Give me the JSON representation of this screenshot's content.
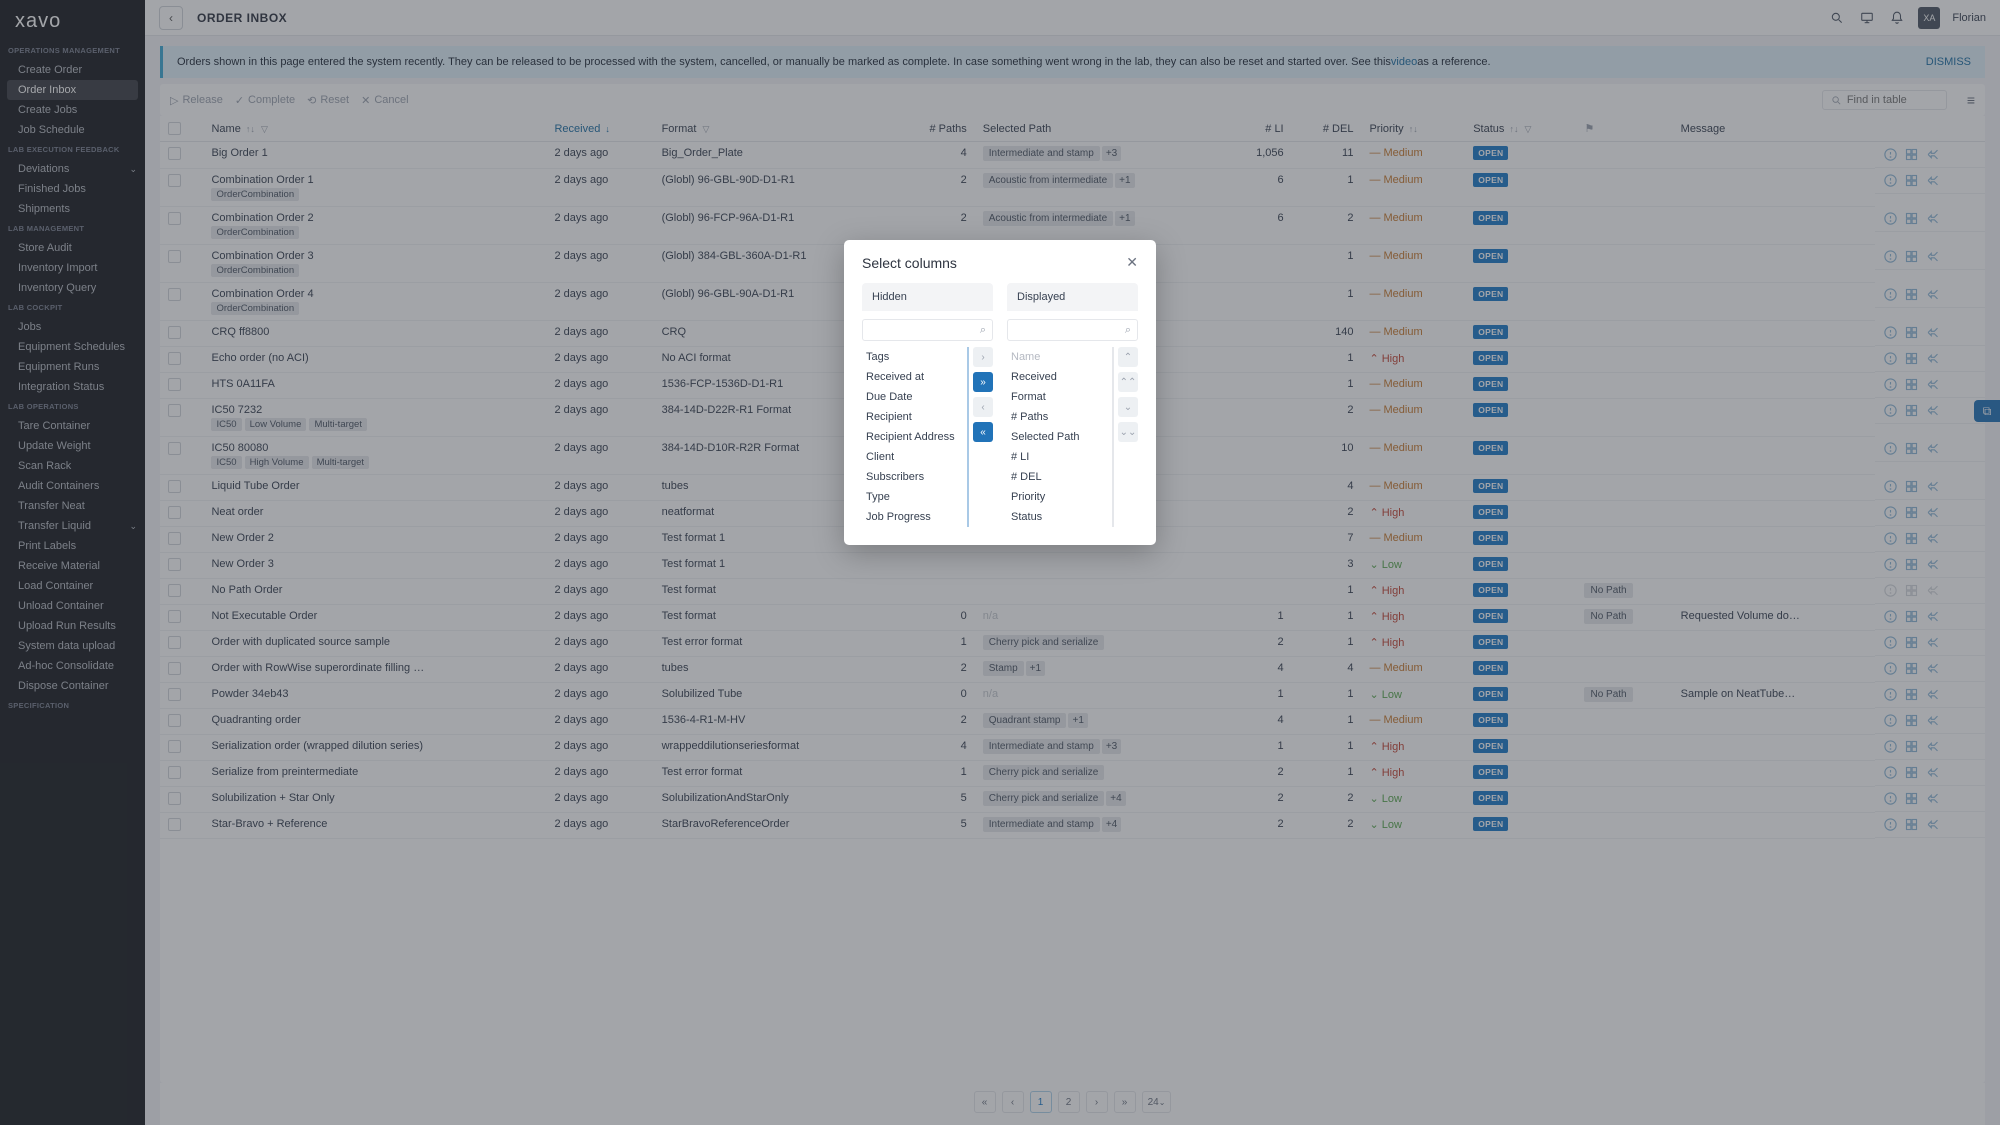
{
  "brand": "xavo",
  "topbar": {
    "page_title": "ORDER INBOX",
    "user_initials": "XA",
    "user_name": "Florian",
    "find_placeholder": "Find in table"
  },
  "sidebar": {
    "faded_item": "Order Inbox",
    "sections": [
      {
        "title": "OPERATIONS MANAGEMENT",
        "items": [
          {
            "label": "Create Order"
          },
          {
            "label": "Order Inbox",
            "active": true
          },
          {
            "label": "Create Jobs"
          },
          {
            "label": "Job Schedule"
          }
        ]
      },
      {
        "title": "LAB EXECUTION FEEDBACK",
        "items": [
          {
            "label": "Deviations",
            "expand": true
          },
          {
            "label": "Finished Jobs"
          },
          {
            "label": "Shipments"
          }
        ]
      },
      {
        "title": "LAB MANAGEMENT",
        "items": [
          {
            "label": "Store Audit"
          },
          {
            "label": "Inventory Import"
          },
          {
            "label": "Inventory Query"
          }
        ]
      },
      {
        "title": "LAB COCKPIT",
        "items": [
          {
            "label": "Jobs"
          },
          {
            "label": "Equipment Schedules"
          },
          {
            "label": "Equipment Runs"
          },
          {
            "label": "Integration Status"
          }
        ]
      },
      {
        "title": "LAB OPERATIONS",
        "items": [
          {
            "label": "Tare Container"
          },
          {
            "label": "Update Weight"
          },
          {
            "label": "Scan Rack"
          },
          {
            "label": "Audit Containers"
          },
          {
            "label": "Transfer Neat"
          },
          {
            "label": "Transfer Liquid",
            "expand": true
          },
          {
            "label": "Print Labels"
          },
          {
            "label": "Receive Material"
          },
          {
            "label": "Load Container"
          },
          {
            "label": "Unload Container"
          },
          {
            "label": "Upload Run Results"
          },
          {
            "label": "System data upload"
          },
          {
            "label": "Ad-hoc Consolidate"
          },
          {
            "label": "Dispose Container"
          }
        ]
      },
      {
        "title": "SPECIFICATION",
        "items": []
      }
    ]
  },
  "banner": {
    "text": "Orders shown in this page entered the system recently. They can be released to be processed with the system, cancelled, or manually be marked as complete. In case something went wrong in the lab, they can also be reset and started over. See this ",
    "link": "video",
    "tail": " as a reference.",
    "dismiss": "DISMISS"
  },
  "toolbar": {
    "release": "Release",
    "complete": "Complete",
    "reset": "Reset",
    "cancel": "Cancel"
  },
  "columns": [
    "",
    "Name",
    "Received",
    "Format",
    "# Paths",
    "Selected Path",
    "# LI",
    "# DEL",
    "Priority",
    "Status",
    "",
    "Message",
    ""
  ],
  "rows": [
    {
      "name": "Big Order 1",
      "tags": [],
      "recv": "2 days ago",
      "fmt": "Big_Order_Plate",
      "paths": 4,
      "selpath": "Intermediate and stamp",
      "selplus": "+3",
      "li": "1,056",
      "del": 11,
      "prio": "Medium",
      "status": "OPEN"
    },
    {
      "name": "Combination Order 1",
      "tags": [
        "OrderCombination"
      ],
      "recv": "2 days ago",
      "fmt": "(Globl) 96-GBL-90D-D1-R1",
      "paths": 2,
      "selpath": "Acoustic from intermediate",
      "selplus": "+1",
      "li": 6,
      "del": 1,
      "prio": "Medium",
      "status": "OPEN"
    },
    {
      "name": "Combination Order 2",
      "tags": [
        "OrderCombination"
      ],
      "recv": "2 days ago",
      "fmt": "(Globl) 96-FCP-96A-D1-R1",
      "paths": 2,
      "selpath": "Acoustic from intermediate",
      "selplus": "+1",
      "li": 6,
      "del": 2,
      "prio": "Medium",
      "status": "OPEN"
    },
    {
      "name": "Combination Order 3",
      "tags": [
        "OrderCombination"
      ],
      "recv": "2 days ago",
      "fmt": "(Globl) 384-GBL-360A-D1-R1",
      "paths": "",
      "selpath": "",
      "li": "",
      "del": 1,
      "prio": "Medium",
      "status": "OPEN"
    },
    {
      "name": "Combination Order 4",
      "tags": [
        "OrderCombination"
      ],
      "recv": "2 days ago",
      "fmt": "(Globl) 96-GBL-90A-D1-R1",
      "paths": "",
      "selpath": "",
      "li": "",
      "del": 1,
      "prio": "Medium",
      "status": "OPEN"
    },
    {
      "name": "CRQ ff8800",
      "tags": [],
      "recv": "2 days ago",
      "fmt": "CRQ",
      "paths": "",
      "selpath": "",
      "li": "",
      "del": 140,
      "prio": "Medium",
      "status": "OPEN"
    },
    {
      "name": "Echo order (no ACI)",
      "tags": [],
      "recv": "2 days ago",
      "fmt": "No ACI format",
      "paths": "",
      "selpath": "",
      "li": "",
      "del": 1,
      "prio": "High",
      "status": "OPEN"
    },
    {
      "name": "HTS 0A11FA",
      "tags": [],
      "recv": "2 days ago",
      "fmt": "1536-FCP-1536D-D1-R1",
      "paths": "",
      "selpath": "",
      "li": "",
      "del": 1,
      "prio": "Medium",
      "status": "OPEN"
    },
    {
      "name": "IC50 7232",
      "tags": [
        "IC50",
        "Low Volume",
        "Multi-target"
      ],
      "recv": "2 days ago",
      "fmt": "384-14D-D22R-R1 Format",
      "paths": "",
      "selpath": "",
      "li": "",
      "del": 2,
      "prio": "Medium",
      "status": "OPEN"
    },
    {
      "name": "IC50 80080",
      "tags": [
        "IC50",
        "High Volume",
        "Multi-target"
      ],
      "recv": "2 days ago",
      "fmt": "384-14D-D10R-R2R Format",
      "paths": "",
      "selpath": "",
      "li": "",
      "del": 10,
      "prio": "Medium",
      "status": "OPEN"
    },
    {
      "name": "Liquid Tube Order",
      "tags": [],
      "recv": "2 days ago",
      "fmt": "tubes",
      "paths": "",
      "selpath": "",
      "li": "",
      "del": 4,
      "prio": "Medium",
      "status": "OPEN"
    },
    {
      "name": "Neat order",
      "tags": [],
      "recv": "2 days ago",
      "fmt": "neatformat",
      "paths": "",
      "selpath": "",
      "li": "",
      "del": 2,
      "prio": "High",
      "status": "OPEN"
    },
    {
      "name": "New Order 2",
      "tags": [],
      "recv": "2 days ago",
      "fmt": "Test format 1",
      "paths": "",
      "selpath": "",
      "li": "",
      "del": 7,
      "prio": "Medium",
      "status": "OPEN"
    },
    {
      "name": "New Order 3",
      "tags": [],
      "recv": "2 days ago",
      "fmt": "Test format 1",
      "paths": "",
      "selpath": "",
      "li": "",
      "del": 3,
      "prio": "Low",
      "status": "OPEN"
    },
    {
      "name": "No Path Order",
      "tags": [],
      "recv": "2 days ago",
      "fmt": "Test format",
      "paths": "",
      "selpath": "",
      "li": "",
      "del": 1,
      "prio": "High",
      "status": "OPEN",
      "msgpill": "No Path",
      "actdis": true
    },
    {
      "name": "Not Executable Order",
      "tags": [],
      "recv": "2 days ago",
      "fmt": "Test format",
      "paths": 0,
      "selpath": "n/a",
      "na": true,
      "li": 1,
      "del": 1,
      "prio": "High",
      "status": "OPEN",
      "msgpill": "No Path",
      "msg": "Requested Volume do…"
    },
    {
      "name": "Order with duplicated source sample",
      "tags": [],
      "recv": "2 days ago",
      "fmt": "Test error format",
      "paths": 1,
      "selpath": "Cherry pick and serialize",
      "li": 2,
      "del": 1,
      "prio": "High",
      "status": "OPEN"
    },
    {
      "name": "Order with RowWise superordinate filling …",
      "tags": [],
      "recv": "2 days ago",
      "fmt": "tubes",
      "paths": 2,
      "selpath": "Stamp",
      "selplus": "+1",
      "li": 4,
      "del": 4,
      "prio": "Medium",
      "status": "OPEN"
    },
    {
      "name": "Powder 34eb43",
      "tags": [],
      "recv": "2 days ago",
      "fmt": "Solubilized Tube",
      "paths": 0,
      "selpath": "n/a",
      "na": true,
      "li": 1,
      "del": 1,
      "prio": "Low",
      "status": "OPEN",
      "msgpill": "No Path",
      "msg": "Sample on NeatTube…"
    },
    {
      "name": "Quadranting order",
      "tags": [],
      "recv": "2 days ago",
      "fmt": "1536-4-R1-M-HV",
      "paths": 2,
      "selpath": "Quadrant stamp",
      "selplus": "+1",
      "li": 4,
      "del": 1,
      "prio": "Medium",
      "status": "OPEN"
    },
    {
      "name": "Serialization order (wrapped dilution series)",
      "tags": [],
      "recv": "2 days ago",
      "fmt": "wrappeddilutionseriesformat",
      "paths": 4,
      "selpath": "Intermediate and stamp",
      "selplus": "+3",
      "li": 1,
      "del": 1,
      "prio": "High",
      "status": "OPEN"
    },
    {
      "name": "Serialize from preintermediate",
      "tags": [],
      "recv": "2 days ago",
      "fmt": "Test error format",
      "paths": 1,
      "selpath": "Cherry pick and serialize",
      "li": 2,
      "del": 1,
      "prio": "High",
      "status": "OPEN"
    },
    {
      "name": "Solubilization + Star Only",
      "tags": [],
      "recv": "2 days ago",
      "fmt": "SolubilizationAndStarOnly",
      "paths": 5,
      "selpath": "Cherry pick and serialize",
      "selplus": "+4",
      "li": 2,
      "del": 2,
      "prio": "Low",
      "status": "OPEN"
    },
    {
      "name": "Star-Bravo + Reference",
      "tags": [],
      "recv": "2 days ago",
      "fmt": "StarBravoReferenceOrder",
      "paths": 5,
      "selpath": "Intermediate and stamp",
      "selplus": "+4",
      "li": 2,
      "del": 2,
      "prio": "Low",
      "status": "OPEN"
    }
  ],
  "pager": {
    "pages": [
      "1",
      "2"
    ],
    "size": "24"
  },
  "modal": {
    "title": "Select columns",
    "hidden_label": "Hidden",
    "displayed_label": "Displayed",
    "hidden": [
      "Tags",
      "Received at",
      "Due Date",
      "Recipient",
      "Recipient Address",
      "Client",
      "Subscribers",
      "Type",
      "Job Progress"
    ],
    "displayed": [
      "Name",
      "Received",
      "Format",
      "# Paths",
      "Selected Path",
      "# LI",
      "# DEL",
      "Priority",
      "Status"
    ]
  }
}
